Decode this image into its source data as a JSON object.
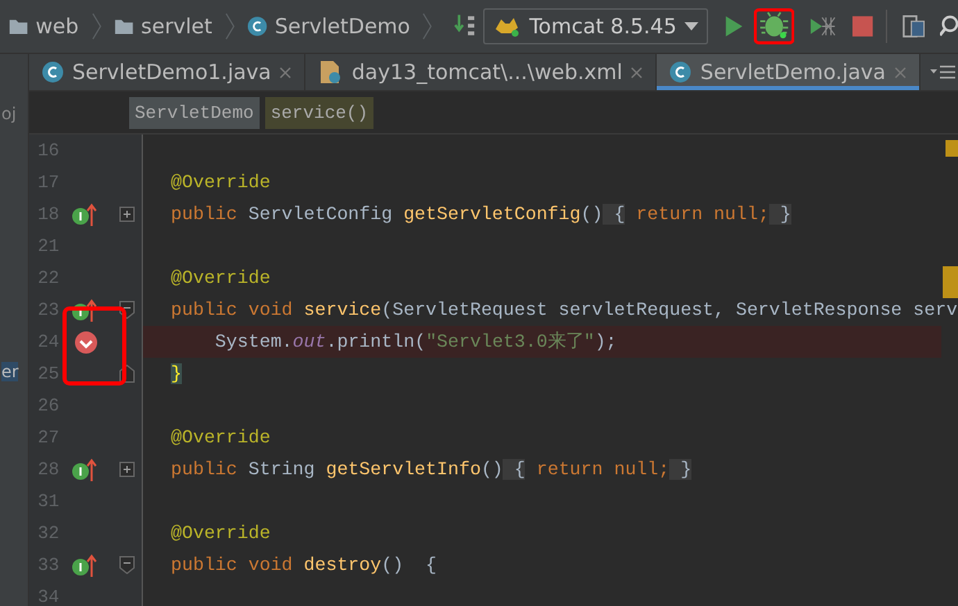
{
  "toolbar": {
    "breadcrumbs": [
      {
        "kind": "folder",
        "label": "web"
      },
      {
        "kind": "folder",
        "label": "servlet"
      },
      {
        "kind": "class",
        "label": "ServletDemo"
      }
    ],
    "run_config": "Tomcat 8.5.45",
    "debug_highlighted": true
  },
  "tabs": [
    {
      "kind": "class",
      "label": "ServletDemo1.java",
      "selected": false
    },
    {
      "kind": "xml",
      "label": "day13_tomcat\\...\\web.xml",
      "selected": false
    },
    {
      "kind": "class",
      "label": "ServletDemo.java",
      "selected": true
    }
  ],
  "side_panel": [
    "oj",
    "er"
  ],
  "breadcrumb_bar": [
    {
      "label": "ServletDemo",
      "selected": false
    },
    {
      "label": "service()",
      "selected": true
    }
  ],
  "lines": [
    {
      "number": "16",
      "implemented": false,
      "breakpoint": false,
      "fold_start": false,
      "fold_end": false
    },
    {
      "number": "17",
      "implemented": false,
      "breakpoint": false,
      "fold_start": false,
      "fold_end": false,
      "tokens": [
        {
          "kind": "ann",
          "text": "@Override"
        }
      ]
    },
    {
      "number": "18",
      "implemented": true,
      "breakpoint": false,
      "fold_start": true,
      "collapsed": true,
      "fold_end": false,
      "tokens": [
        {
          "kind": "kw",
          "text": "public "
        },
        {
          "kind": "type",
          "text": "ServletConfig "
        },
        {
          "kind": "fn",
          "text": "getServletConfig"
        },
        {
          "kind": "plain",
          "text": "()"
        },
        {
          "kind": "brace",
          "text": " {"
        },
        {
          "kind": "kw",
          "text": " return null;"
        },
        {
          "kind": "brace",
          "text": " }"
        }
      ]
    },
    {
      "number": "21",
      "implemented": false,
      "breakpoint": false,
      "fold_start": false,
      "fold_end": false
    },
    {
      "number": "22",
      "implemented": false,
      "breakpoint": false,
      "fold_start": false,
      "fold_end": false,
      "tokens": [
        {
          "kind": "ann",
          "text": "@Override"
        }
      ]
    },
    {
      "number": "23",
      "implemented": true,
      "breakpoint": false,
      "fold_start": true,
      "collapsed": false,
      "fold_end": false,
      "tokens": [
        {
          "kind": "kw",
          "text": "public void "
        },
        {
          "kind": "fn",
          "text": "service"
        },
        {
          "kind": "plain",
          "text": "(ServletRequest servletRequest, ServletResponse serv"
        }
      ]
    },
    {
      "number": "24",
      "implemented": false,
      "breakpoint": true,
      "highlighted": true,
      "fold_start": false,
      "fold_end": false,
      "tokens": [
        {
          "kind": "plain",
          "text": "    System."
        },
        {
          "kind": "field",
          "text": "out"
        },
        {
          "kind": "plain",
          "text": ".println("
        },
        {
          "kind": "str",
          "text": "\"Servlet3.0来了\""
        },
        {
          "kind": "plain",
          "text": ");"
        }
      ]
    },
    {
      "number": "25",
      "implemented": false,
      "breakpoint": false,
      "fold_start": false,
      "fold_end": true,
      "tokens": [
        {
          "kind": "match",
          "text": "}"
        }
      ]
    },
    {
      "number": "26",
      "implemented": false,
      "breakpoint": false,
      "fold_start": false,
      "fold_end": false
    },
    {
      "number": "27",
      "implemented": false,
      "breakpoint": false,
      "fold_start": false,
      "fold_end": false,
      "tokens": [
        {
          "kind": "ann",
          "text": "@Override"
        }
      ]
    },
    {
      "number": "28",
      "implemented": true,
      "breakpoint": false,
      "fold_start": true,
      "collapsed": true,
      "fold_end": false,
      "tokens": [
        {
          "kind": "kw",
          "text": "public "
        },
        {
          "kind": "type",
          "text": "String "
        },
        {
          "kind": "fn",
          "text": "getServletInfo"
        },
        {
          "kind": "plain",
          "text": "()"
        },
        {
          "kind": "brace",
          "text": " {"
        },
        {
          "kind": "kw",
          "text": " return null;"
        },
        {
          "kind": "brace",
          "text": " }"
        }
      ]
    },
    {
      "number": "31",
      "implemented": false,
      "breakpoint": false,
      "fold_start": false,
      "fold_end": false
    },
    {
      "number": "32",
      "implemented": false,
      "breakpoint": false,
      "fold_start": false,
      "fold_end": false,
      "tokens": [
        {
          "kind": "ann",
          "text": "@Override"
        }
      ]
    },
    {
      "number": "33",
      "implemented": true,
      "breakpoint": false,
      "fold_start": true,
      "collapsed": false,
      "fold_end": false,
      "tokens": [
        {
          "kind": "kw",
          "text": "public void "
        },
        {
          "kind": "fn",
          "text": "destroy"
        },
        {
          "kind": "plain",
          "text": "()  {"
        }
      ]
    },
    {
      "number": "34",
      "implemented": false,
      "breakpoint": false,
      "fold_start": false,
      "fold_end": false
    }
  ]
}
